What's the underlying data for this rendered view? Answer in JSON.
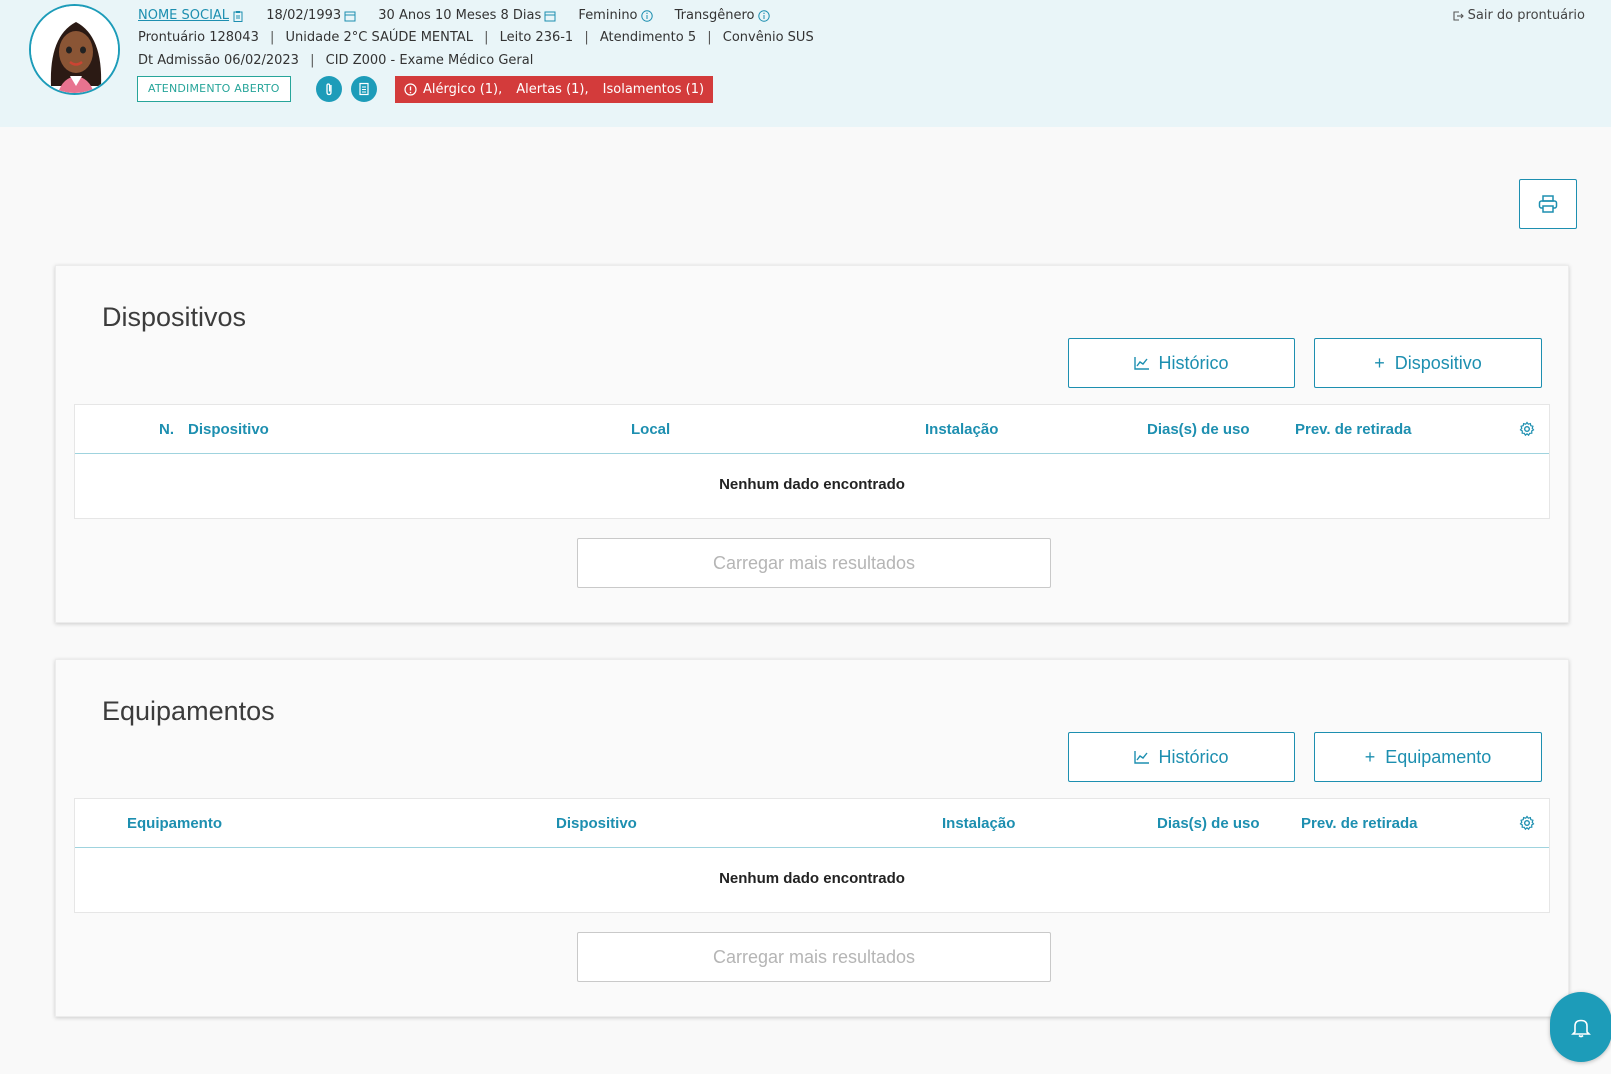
{
  "header": {
    "social_name": "NOME SOCIAL",
    "birth_date": "18/02/1993",
    "age": "30 Anos 10 Meses 8 Dias",
    "gender": "Feminino",
    "identity": "Transgênero",
    "prontuario": "Prontuário 128043",
    "unidade": "Unidade 2°C SAÚDE MENTAL",
    "leito": "Leito 236-1",
    "atendimento": "Atendimento 5",
    "convenio": "Convênio SUS",
    "admissao": "Dt Admissão 06/02/2023",
    "cid": "CID Z000 - Exame Médico Geral",
    "status": "ATENDIMENTO ABERTO",
    "alerts": {
      "alergico": "Alérgico (1),",
      "alertas": "Alertas (1),",
      "isolamentos": "Isolamentos (1)"
    },
    "exit_label": "Sair do prontuário",
    "separator": "|"
  },
  "dispositivos": {
    "title": "Dispositivos",
    "history_label": "Histórico",
    "add_label": "+  Dispositivo",
    "columns": [
      "N.",
      "Dispositivo",
      "Local",
      "Instalação",
      "Dias(s) de uso",
      "Prev. de retirada"
    ],
    "empty_text": "Nenhum dado encontrado",
    "load_more": "Carregar mais resultados"
  },
  "equipamentos": {
    "title": "Equipamentos",
    "history_label": "Histórico",
    "add_label": "+  Equipamento",
    "columns": [
      "Equipamento",
      "Dispositivo",
      "Instalação",
      "Dias(s) de uso",
      "Prev. de retirada"
    ],
    "empty_text": "Nenhum dado encontrado",
    "load_more": "Carregar mais resultados"
  },
  "colors": {
    "accent": "#1d8fb0",
    "alert": "#d33b3b",
    "status": "#27a59a",
    "header_bg": "#e9f5f8"
  },
  "icons": [
    "calendar-icon",
    "clipboard-icon",
    "info-icon",
    "paperclip-icon",
    "document-icon",
    "alert-circle-icon",
    "exit-icon",
    "printer-icon",
    "chart-icon",
    "gear-icon",
    "bell-icon"
  ]
}
